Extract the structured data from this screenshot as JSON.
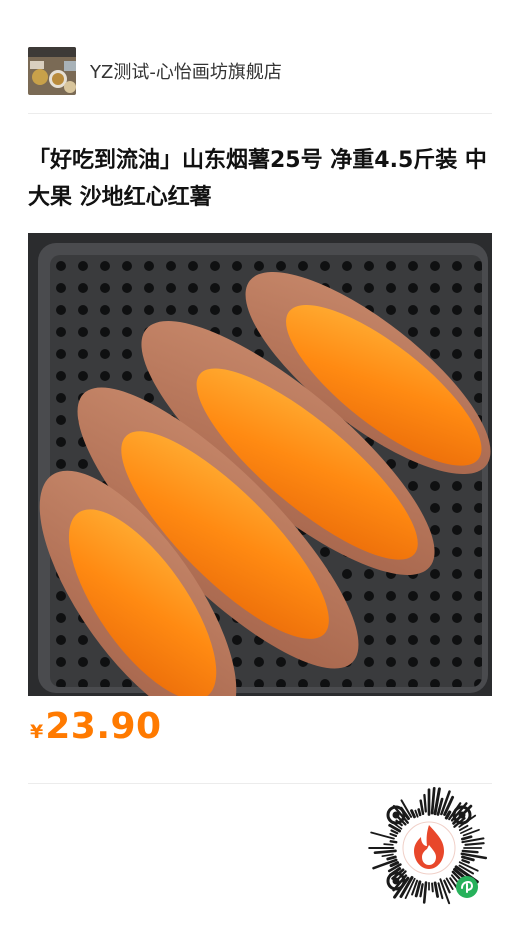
{
  "shop": {
    "name": "YZ测试-心怡画坊旗舰店"
  },
  "product": {
    "title": "「好吃到流油」山东烟薯25号 净重4.5斤装 中大果 沙地红心红薯",
    "currency_symbol": "¥",
    "price": "23.90"
  },
  "colors": {
    "price": "#ff7a00",
    "divider": "#ececec",
    "qr_flame": "#e8472b",
    "qr_badge": "#27b15b"
  },
  "icons": {
    "qr": "mini-program-qr-code",
    "flame": "flame-logo-icon",
    "badge": "mini-program-badge-icon"
  }
}
